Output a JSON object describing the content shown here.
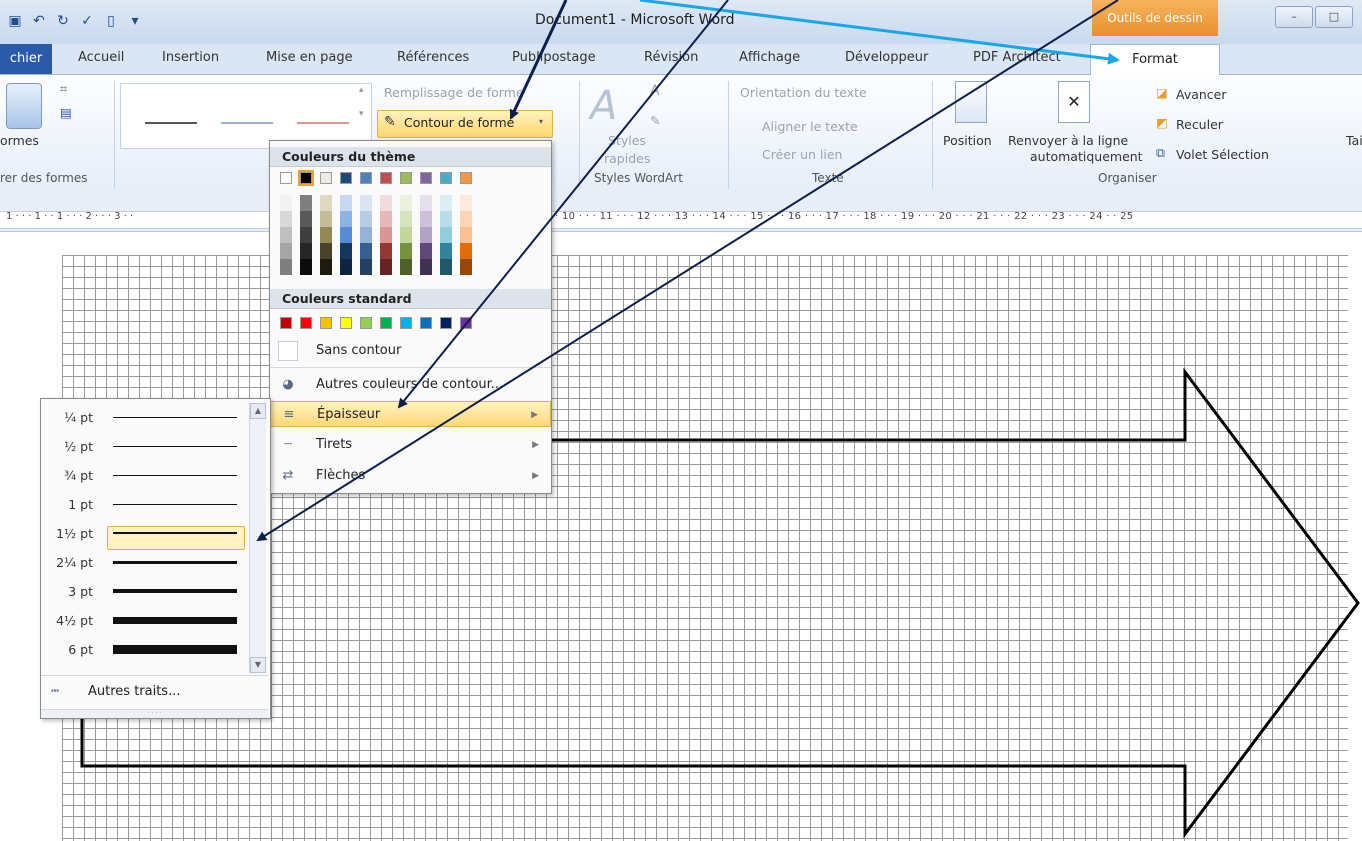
{
  "window": {
    "title": "Document1 - Microsoft Word",
    "contextual_tab": "Outils de dessin",
    "buttons": [
      "–",
      "□"
    ]
  },
  "tabs": {
    "file": "chier",
    "items": [
      "Accueil",
      "Insertion",
      "Mise en page",
      "Références",
      "Publipostage",
      "Révision",
      "Affichage",
      "Développeur",
      "PDF Architect"
    ],
    "active": "Format"
  },
  "ribbon": {
    "insert_shapes": {
      "label": "ormes",
      "group": "rer des formes"
    },
    "shape_styles": {
      "fill": "Remplissage de forme",
      "outline": "Contour de forme"
    },
    "wordart": {
      "styles": "Styles",
      "rapides": "rapides",
      "group": "Styles WordArt"
    },
    "text": {
      "orientation": "Orientation du texte",
      "align": "Aligner le texte",
      "link": "Créer un lien",
      "group": "Texte"
    },
    "arrange": {
      "position": "Position",
      "wrap1": "Renvoyer à la ligne",
      "wrap2": "automatiquement",
      "forward": "Avancer",
      "backward": "Reculer",
      "selection": "Volet Sélection",
      "group": "Organiser"
    },
    "size": {
      "label": "Tai"
    }
  },
  "ruler": {
    "left": "1 · · · 1 · · 1 · · · 2 · · · 3 · ·",
    "right": "· 10 · · · 11 · · · 12 · · · 13 · · · 14 · · · 15 · · · 16 · · · 17 · · · 18 · · · 19 · · · 20 · · · 21 · · · 22 · · · 23 · · · 24 · · 25"
  },
  "color_menu": {
    "theme_header": "Couleurs du thème",
    "standard_header": "Couleurs standard",
    "no_outline": "Sans contour",
    "more_colors": "Autres couleurs de contour...",
    "weight": "Épaisseur",
    "dashes": "Tirets",
    "arrows": "Flèches",
    "theme_top": [
      "#ffffff",
      "#000000",
      "#eeece1",
      "#1f497d",
      "#4f81bd",
      "#c0504d",
      "#9bbb59",
      "#8064a2",
      "#4bacc6",
      "#f79646"
    ],
    "theme_columns": [
      [
        "#f2f2f2",
        "#d8d8d8",
        "#bfbfbf",
        "#a5a5a5",
        "#7f7f7f"
      ],
      [
        "#7f7f7f",
        "#595959",
        "#3f3f3f",
        "#262626",
        "#0c0c0c"
      ],
      [
        "#ddd9c3",
        "#c4bd97",
        "#938953",
        "#494429",
        "#1d1b10"
      ],
      [
        "#c6d9f0",
        "#8db3e2",
        "#548dd4",
        "#17365d",
        "#0f243e"
      ],
      [
        "#dbe5f1",
        "#b8cce4",
        "#95b3d7",
        "#366092",
        "#244061"
      ],
      [
        "#f2dcdb",
        "#e5b9b7",
        "#d99694",
        "#953734",
        "#632423"
      ],
      [
        "#ebf1dd",
        "#d7e3bc",
        "#c3d69b",
        "#76923c",
        "#4f6128"
      ],
      [
        "#e5e0ec",
        "#ccc1d9",
        "#b2a2c7",
        "#5f497a",
        "#3f3151"
      ],
      [
        "#dbeef3",
        "#b7dde8",
        "#92cddc",
        "#31859b",
        "#205867"
      ],
      [
        "#fdeada",
        "#fbd5b5",
        "#fac08f",
        "#e36c09",
        "#974806"
      ]
    ],
    "standard": [
      "#c00000",
      "#ff0000",
      "#ffc000",
      "#ffff00",
      "#92d050",
      "#00b050",
      "#00b0f0",
      "#0070c0",
      "#002060",
      "#7030a0"
    ]
  },
  "weight_menu": {
    "items": [
      {
        "label": "¼ pt",
        "value": 0.25
      },
      {
        "label": "½ pt",
        "value": 0.5
      },
      {
        "label": "¾ pt",
        "value": 0.75
      },
      {
        "label": "1 pt",
        "value": 1
      },
      {
        "label": "1½ pt",
        "value": 1.5
      },
      {
        "label": "2¼ pt",
        "value": 2.25
      },
      {
        "label": "3 pt",
        "value": 3
      },
      {
        "label": "4½ pt",
        "value": 4.5
      },
      {
        "label": "6 pt",
        "value": 6
      }
    ],
    "selected": "1½ pt",
    "more": "Autres traits..."
  }
}
